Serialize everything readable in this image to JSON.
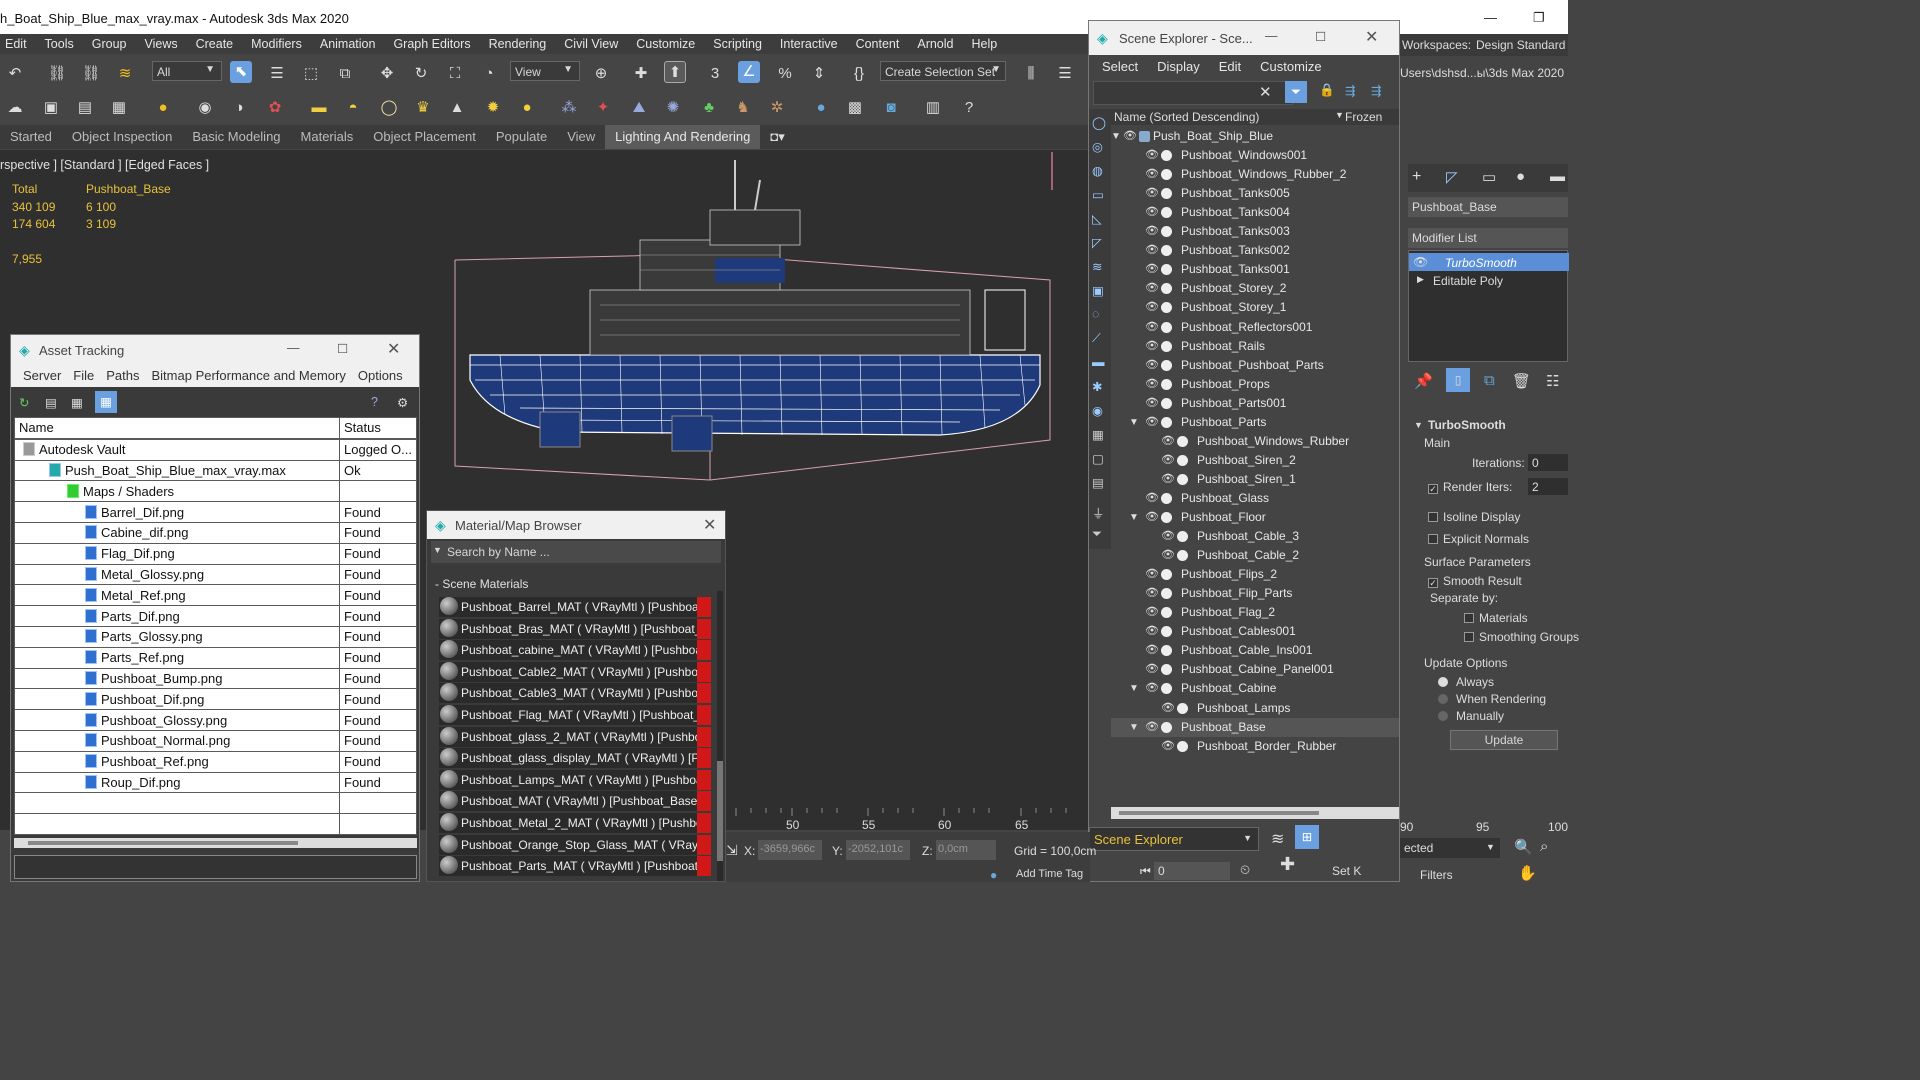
{
  "window": {
    "title": "h_Boat_Ship_Blue_max_vray.max - Autodesk 3ds Max 2020",
    "minimize": "—",
    "restore": "❐"
  },
  "menu": [
    "Edit",
    "Tools",
    "Group",
    "Views",
    "Create",
    "Modifiers",
    "Animation",
    "Graph Editors",
    "Rendering",
    "Civil View",
    "Customize",
    "Scripting",
    "Interactive",
    "Content",
    "Arnold",
    "Help"
  ],
  "toolbar": {
    "filter": "All",
    "refcoord": "View",
    "selset": "Create Selection Set"
  },
  "ribbon": {
    "tabs": [
      "Started",
      "Object Inspection",
      "Basic Modeling",
      "Materials",
      "Object Placement",
      "Populate",
      "View",
      "Lighting And Rendering"
    ],
    "active": "Lighting And Rendering"
  },
  "viewport": {
    "label": "rspective ] [Standard ] [Edged Faces ]",
    "stats": {
      "h1": "Total",
      "h2": "Pushboat_Base",
      "r1a": "340 109",
      "r1b": "6 100",
      "r2a": "174 604",
      "r2b": "3 109",
      "fps": "7,955"
    }
  },
  "asset": {
    "title": "Asset Tracking",
    "menu": [
      "Server",
      "File",
      "Paths",
      "Bitmap Performance and Memory",
      "Options"
    ],
    "cols": [
      "Name",
      "Status"
    ],
    "rows": [
      {
        "name": "Autodesk Vault",
        "status": "Logged O..."
      },
      {
        "name": "Push_Boat_Ship_Blue_max_vray.max",
        "status": "Ok"
      },
      {
        "name": "Maps / Shaders",
        "status": ""
      },
      {
        "name": "Barrel_Dif.png",
        "status": "Found"
      },
      {
        "name": "Cabine_dif.png",
        "status": "Found"
      },
      {
        "name": "Flag_Dif.png",
        "status": "Found"
      },
      {
        "name": "Metal_Glossy.png",
        "status": "Found"
      },
      {
        "name": "Metal_Ref.png",
        "status": "Found"
      },
      {
        "name": "Parts_Dif.png",
        "status": "Found"
      },
      {
        "name": "Parts_Glossy.png",
        "status": "Found"
      },
      {
        "name": "Parts_Ref.png",
        "status": "Found"
      },
      {
        "name": "Pushboat_Bump.png",
        "status": "Found"
      },
      {
        "name": "Pushboat_Dif.png",
        "status": "Found"
      },
      {
        "name": "Pushboat_Glossy.png",
        "status": "Found"
      },
      {
        "name": "Pushboat_Normal.png",
        "status": "Found"
      },
      {
        "name": "Pushboat_Ref.png",
        "status": "Found"
      },
      {
        "name": "Roup_Dif.png",
        "status": "Found"
      }
    ]
  },
  "matbrowser": {
    "title": "Material/Map Browser",
    "search": "Search by Name ...",
    "section": "- Scene Materials",
    "items": [
      "Pushboat_Barrel_MAT  ( VRayMtl )  [Pushboat...",
      "Pushboat_Bras_MAT  ( VRayMtl )  [Pushboat_...",
      "Pushboat_cabine_MAT  ( VRayMtl )  [Pushboa...",
      "Pushboat_Cable2_MAT  ( VRayMtl )  [Pushboa...",
      "Pushboat_Cable3_MAT  ( VRayMtl )  [Pushboa...",
      "Pushboat_Flag_MAT  ( VRayMtl )  [Pushboat_...",
      "Pushboat_glass_2_MAT  ( VRayMtl )  [Pushbo...",
      "Pushboat_glass_display_MAT  ( VRayMtl )  [P...",
      "Pushboat_Lamps_MAT  ( VRayMtl )  [Pushboa...",
      "Pushboat_MAT  ( VRayMtl )  [Pushboat_Base,...",
      "Pushboat_Metal_2_MAT  ( VRayMtl )  [Pushbo...",
      "Pushboat_Orange_Stop_Glass_MAT  ( VRayMt...",
      "Pushboat_Parts_MAT  ( VRayMtl )  [Pushboat..."
    ]
  },
  "sceneexplorer": {
    "title": "Scene Explorer - Sce...",
    "menu": [
      "Select",
      "Display",
      "Edit",
      "Customize"
    ],
    "col": "Name (Sorted Descending)",
    "frozen": "Frozen",
    "footer": "Scene Explorer",
    "items": [
      {
        "name": "Push_Boat_Ship_Blue",
        "level": 0,
        "expand": true
      },
      {
        "name": "Pushboat_Windows001",
        "level": 1
      },
      {
        "name": "Pushboat_Windows_Rubber_2",
        "level": 1
      },
      {
        "name": "Pushboat_Tanks005",
        "level": 1
      },
      {
        "name": "Pushboat_Tanks004",
        "level": 1
      },
      {
        "name": "Pushboat_Tanks003",
        "level": 1
      },
      {
        "name": "Pushboat_Tanks002",
        "level": 1
      },
      {
        "name": "Pushboat_Tanks001",
        "level": 1
      },
      {
        "name": "Pushboat_Storey_2",
        "level": 1
      },
      {
        "name": "Pushboat_Storey_1",
        "level": 1
      },
      {
        "name": "Pushboat_Reflectors001",
        "level": 1
      },
      {
        "name": "Pushboat_Rails",
        "level": 1
      },
      {
        "name": "Pushboat_Pushboat_Parts",
        "level": 1
      },
      {
        "name": "Pushboat_Props",
        "level": 1
      },
      {
        "name": "Pushboat_Parts001",
        "level": 1
      },
      {
        "name": "Pushboat_Parts",
        "level": 1,
        "expand": true
      },
      {
        "name": "Pushboat_Windows_Rubber",
        "level": 2
      },
      {
        "name": "Pushboat_Siren_2",
        "level": 2
      },
      {
        "name": "Pushboat_Siren_1",
        "level": 2
      },
      {
        "name": "Pushboat_Glass",
        "level": 1
      },
      {
        "name": "Pushboat_Floor",
        "level": 1,
        "expand": true
      },
      {
        "name": "Pushboat_Cable_3",
        "level": 2
      },
      {
        "name": "Pushboat_Cable_2",
        "level": 2
      },
      {
        "name": "Pushboat_Flips_2",
        "level": 1
      },
      {
        "name": "Pushboat_Flip_Parts",
        "level": 1
      },
      {
        "name": "Pushboat_Flag_2",
        "level": 1
      },
      {
        "name": "Pushboat_Cables001",
        "level": 1
      },
      {
        "name": "Pushboat_Cable_Ins001",
        "level": 1
      },
      {
        "name": "Pushboat_Cabine_Panel001",
        "level": 1
      },
      {
        "name": "Pushboat_Cabine",
        "level": 1,
        "expand": true
      },
      {
        "name": "Pushboat_Lamps",
        "level": 2
      },
      {
        "name": "Pushboat_Base",
        "level": 1,
        "expand": true,
        "selected": true
      },
      {
        "name": "Pushboat_Border_Rubber",
        "level": 2
      }
    ]
  },
  "rightpanel": {
    "workspaces": "Workspaces:",
    "workspace": "Design Standard",
    "path": "Users\\dshsd...ы\\3ds Max 2020",
    "objname": "Pushboat_Base",
    "modlist": "Modifier List",
    "mod1": "TurboSmooth",
    "mod2": "Editable Poly",
    "ts": "TurboSmooth",
    "main": "Main",
    "iter_l": "Iterations:",
    "iter_v": "0",
    "riter_l": "Render Iters:",
    "riter_v": "2",
    "isoline": "Isoline Display",
    "explicit": "Explicit Normals",
    "surf": "Surface Parameters",
    "smooth": "Smooth Result",
    "sepby": "Separate by:",
    "materials": "Materials",
    "sgroups": "Smoothing Groups",
    "upd": "Update Options",
    "always": "Always",
    "whenr": "When Rendering",
    "manually": "Manually",
    "update": "Update",
    "selected": "ected",
    "filters": "Filters"
  },
  "status": {
    "x_l": "X:",
    "x": "-3659,966c",
    "y_l": "Y:",
    "y": "-2052,101c",
    "z_l": "Z:",
    "z": "0,0cm",
    "grid": "Grid = 100,0cm",
    "addtime": "Add Time Tag",
    "setk": "Set K",
    "frame": "0"
  },
  "timeline": {
    "ticks": [
      "50",
      "55",
      "60",
      "65"
    ],
    "rticks": [
      "90",
      "95",
      "100"
    ]
  }
}
